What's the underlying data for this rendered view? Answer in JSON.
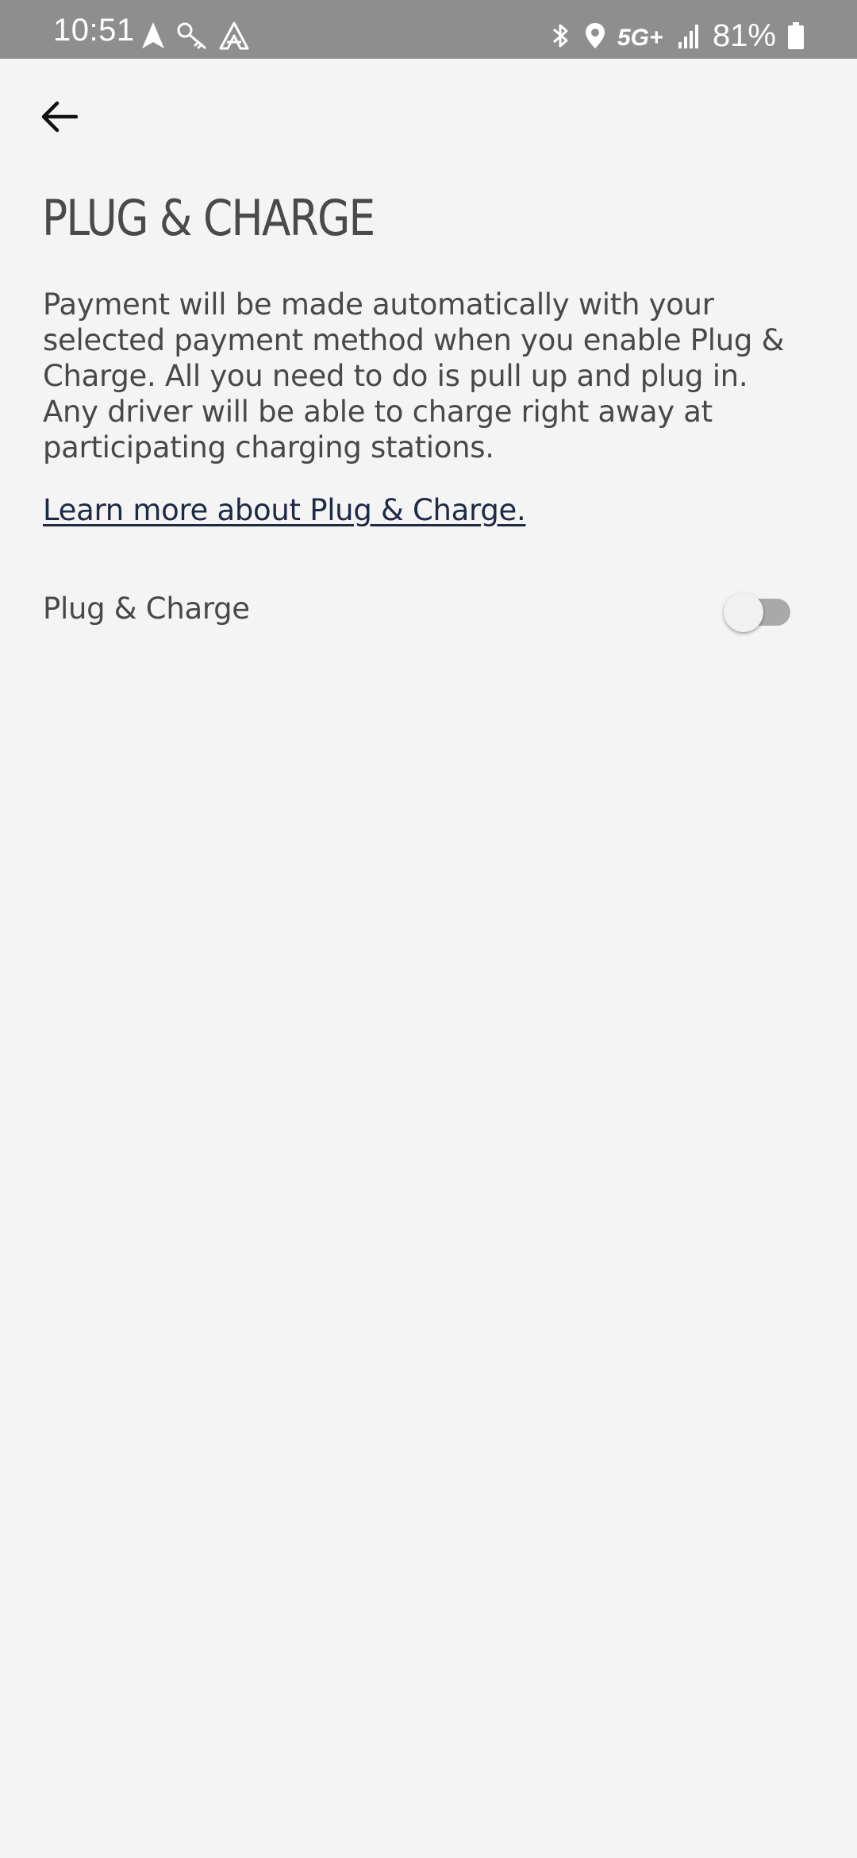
{
  "status_bar": {
    "time": "10:51",
    "battery": "81%",
    "network": "5G+",
    "left_icons": [
      "navigation-arrow-icon",
      "key-icon",
      "android-auto-icon"
    ],
    "right_icons": [
      "bluetooth-icon",
      "location-pin-icon",
      "5g-plus-icon",
      "signal-bars-icon",
      "battery-icon"
    ]
  },
  "header": {
    "back_icon": "arrow-left-icon"
  },
  "page": {
    "title": "PLUG & CHARGE",
    "description": "Payment will be made automatically with your selected payment method when you enable Plug & Charge. All you need to do is pull up and plug in. Any driver will be able to charge right away at participating charging stations.",
    "learn_more_link": "Learn more about Plug & Charge."
  },
  "settings": {
    "plug_and_charge": {
      "label": "Plug & Charge",
      "enabled": false
    }
  },
  "colors": {
    "background": "#f4f4f4",
    "status_bar": "#8e8e8e",
    "text": "#484848",
    "link": "#1e2a44",
    "toggle_track_off": "#a9a9a9",
    "toggle_thumb": "#f1f1f1"
  }
}
